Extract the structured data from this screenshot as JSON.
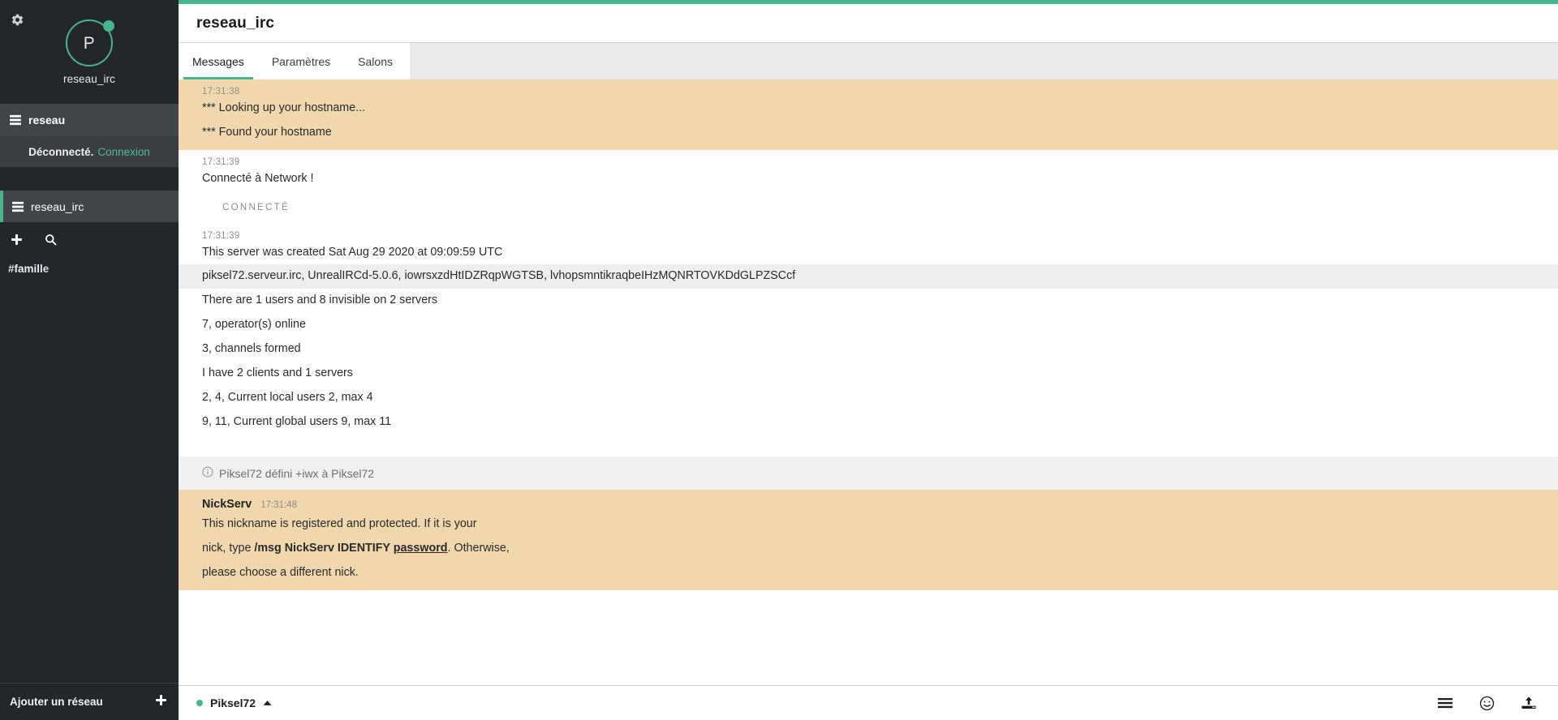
{
  "sidebar": {
    "settings_icon": "gear-icon",
    "avatar": {
      "letter": "P",
      "name": "reseau_irc",
      "status": "online"
    },
    "network": {
      "label": "reseau",
      "icon": "server-icon"
    },
    "connection_status": {
      "text": "Déconnecté.",
      "action": "Connexion"
    },
    "channel_item": {
      "label": "reseau_irc",
      "icon": "server-icon"
    },
    "tools": {
      "add_icon": "plus-icon",
      "search_icon": "search-icon"
    },
    "famille": {
      "label": "#famille"
    },
    "add_network": {
      "label": "Ajouter un réseau",
      "icon": "plus-icon"
    }
  },
  "header": {
    "title": "reseau_irc"
  },
  "tabs": [
    {
      "label": "Messages",
      "active": true
    },
    {
      "label": "Paramètres",
      "active": false
    },
    {
      "label": "Salons",
      "active": false
    }
  ],
  "messages": {
    "group1": {
      "timestamp": "17:31:38",
      "lines": [
        "*** Looking up your hostname...",
        "*** Found your hostname"
      ]
    },
    "group2": {
      "timestamp": "17:31:39",
      "lines": [
        "Connecté à Network !"
      ]
    },
    "divider": "CONNECTÉ",
    "group3": {
      "timestamp": "17:31:39",
      "line1": "This server was created Sat Aug 29 2020 at 09:09:59 UTC",
      "line2": "piksel72.serveur.irc, UnrealIRCd-5.0.6, iowrsxzdHtIDZRqpWGTSB, lvhopsmntikraqbeIHzMQNRTOVKDdGLPZSCcf",
      "line3": "There are 1 users and 8 invisible on 2 servers",
      "line4": "7, operator(s) online",
      "line5": "3, channels formed",
      "line6": "I have 2 clients and 1 servers",
      "line7": "2, 4, Current local users 2, max 4",
      "line8": "9, 11, Current global users 9, max 11"
    },
    "notice": {
      "icon": "info-icon",
      "text": "Piksel72 défini +iwx à Piksel72"
    },
    "nickserv": {
      "nick": "NickServ",
      "timestamp": "17:31:48",
      "line1": "This nickname is registered and protected.  If it is your",
      "line2_a": "nick, type ",
      "line2_b": "/msg NickServ IDENTIFY ",
      "line2_c": "password",
      "line2_d": ".  Otherwise,",
      "line3": "please choose a different nick."
    }
  },
  "composer": {
    "nick": "Piksel72",
    "expand_icon": "chevron-up-icon",
    "input_placeholder": "",
    "input_value": "",
    "icons": [
      "menu-icon",
      "emoji-icon",
      "upload-icon"
    ]
  },
  "colors": {
    "accent_green": "#46b58c",
    "sidebar_bg": "#23262a",
    "sidebar_row_active": "#41454a",
    "highlight_bg": "#f0d7ad",
    "notice_bg": "#f0f0f0",
    "shaded_line": "#eeeeee"
  }
}
